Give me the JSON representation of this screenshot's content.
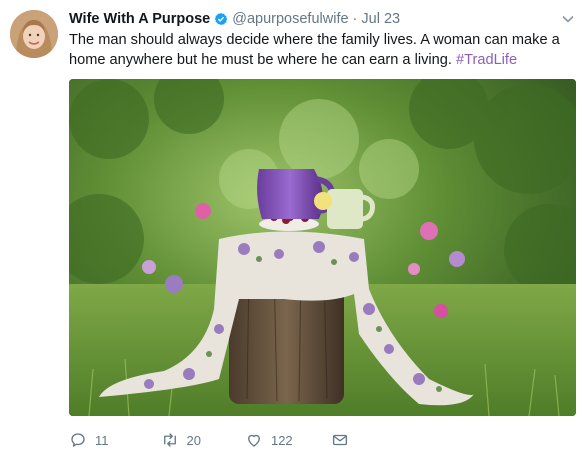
{
  "tweet": {
    "display_name": "Wife With A Purpose",
    "handle": "@apurposefulwife",
    "separator": "·",
    "date": "Jul 23",
    "text": "The man should always decide where the family lives. A woman can make a home anywhere but he must be where he can earn a living.",
    "hashtag": "#TradLife",
    "verified": true
  },
  "actions": {
    "replies": "11",
    "retweets": "20",
    "likes": "122"
  },
  "icons": {
    "verified": "verified-badge-icon",
    "caret": "chevron-down-icon",
    "reply": "reply-icon",
    "retweet": "retweet-icon",
    "like": "heart-icon",
    "message": "envelope-icon"
  },
  "colors": {
    "text": "#14171a",
    "secondary": "#657786",
    "verified": "#1da1f2",
    "hashtag": "#8f5db7"
  }
}
